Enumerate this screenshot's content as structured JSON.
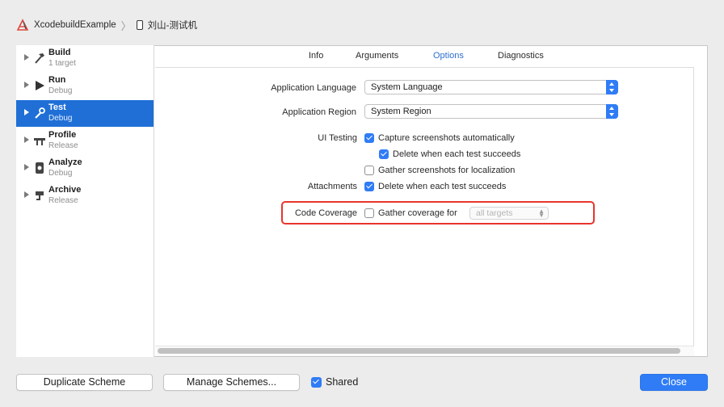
{
  "scheme_bar": {
    "scheme_name": "XcodebuildExample",
    "separator": "〉",
    "destination": "刘山-测试机"
  },
  "sidebar": {
    "items": [
      {
        "name": "Build",
        "sub": "1 target",
        "icon": "hammer-icon"
      },
      {
        "name": "Run",
        "sub": "Debug",
        "icon": "play-icon"
      },
      {
        "name": "Test",
        "sub": "Debug",
        "icon": "wrench-icon",
        "selected": true
      },
      {
        "name": "Profile",
        "sub": "Release",
        "icon": "instruments-icon"
      },
      {
        "name": "Analyze",
        "sub": "Debug",
        "icon": "analyze-icon"
      },
      {
        "name": "Archive",
        "sub": "Release",
        "icon": "archive-icon"
      }
    ]
  },
  "tabs": [
    "Info",
    "Arguments",
    "Options",
    "Diagnostics"
  ],
  "active_tab": "Options",
  "options": {
    "app_language_label": "Application Language",
    "app_language_value": "System Language",
    "app_region_label": "Application Region",
    "app_region_value": "System Region",
    "ui_testing_label": "UI Testing",
    "capture_screenshots": {
      "label": "Capture screenshots automatically",
      "checked": true
    },
    "delete_when_succeeds": {
      "label": "Delete when each test succeeds",
      "checked": true
    },
    "gather_localization": {
      "label": "Gather screenshots for localization",
      "checked": false
    },
    "attachments_label": "Attachments",
    "attachments_delete": {
      "label": "Delete when each test succeeds",
      "checked": true
    },
    "code_coverage_label": "Code Coverage",
    "gather_coverage": {
      "label": "Gather coverage for",
      "checked": false
    },
    "coverage_targets": "all targets"
  },
  "footer": {
    "duplicate_label": "Duplicate Scheme",
    "manage_label": "Manage Schemes...",
    "shared_label": "Shared",
    "shared_checked": true,
    "close_label": "Close"
  },
  "colors": {
    "accent": "#2f7cf6",
    "selection": "#1f6fd6",
    "highlight_box": "#e8352d"
  }
}
